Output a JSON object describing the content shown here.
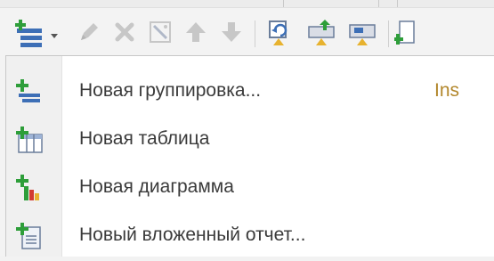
{
  "toolbar": {
    "buttons": [
      {
        "icon": "add-grouping-icon",
        "has_dropdown": true
      },
      {
        "icon": "pencil-icon"
      },
      {
        "icon": "delete-icon"
      },
      {
        "icon": "settings-wand-icon"
      },
      {
        "icon": "arrow-up-icon"
      },
      {
        "icon": "arrow-down-icon"
      },
      {
        "icon": "move-level-up-icon"
      },
      {
        "icon": "move-into-icon"
      },
      {
        "icon": "move-out-icon"
      },
      {
        "icon": "add-item-icon"
      }
    ]
  },
  "menu": {
    "items": [
      {
        "label": "Новая группировка...",
        "shortcut": "Ins",
        "icon": "new-grouping-icon"
      },
      {
        "label": "Новая таблица",
        "shortcut": "",
        "icon": "new-table-icon"
      },
      {
        "label": "Новая диаграмма",
        "shortcut": "",
        "icon": "new-chart-icon"
      },
      {
        "label": "Новый вложенный отчет...",
        "shortcut": "",
        "icon": "new-nested-report-icon"
      }
    ]
  },
  "colors": {
    "green": "#2e9e3a",
    "blue": "#3d6fb6",
    "grey_disabled": "#c7c7c7",
    "shortcut": "#b2872c",
    "yellow": "#e7b22f"
  }
}
